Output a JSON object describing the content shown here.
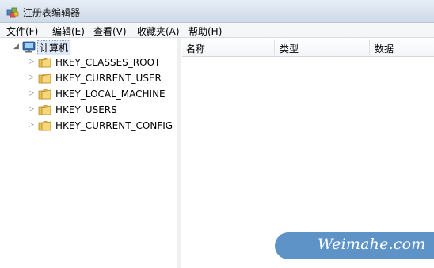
{
  "window": {
    "title": "注册表编辑器",
    "icon": "registry-editor-icon"
  },
  "menu": [
    {
      "label": "文件(F)"
    },
    {
      "label": "编辑(E)"
    },
    {
      "label": "查看(V)"
    },
    {
      "label": "收藏夹(A)"
    },
    {
      "label": "帮助(H)"
    }
  ],
  "tree": {
    "root": {
      "label": "计算机",
      "icon": "computer-icon",
      "expanded": true
    },
    "hives": [
      {
        "label": "HKEY_CLASSES_ROOT"
      },
      {
        "label": "HKEY_CURRENT_USER"
      },
      {
        "label": "HKEY_LOCAL_MACHINE"
      },
      {
        "label": "HKEY_USERS"
      },
      {
        "label": "HKEY_CURRENT_CONFIG"
      }
    ]
  },
  "list": {
    "columns": [
      {
        "label": "名称"
      },
      {
        "label": "类型"
      },
      {
        "label": "数据"
      }
    ]
  },
  "watermark": {
    "text": "Weimahe.com"
  },
  "colors": {
    "title_bar": "#dbe4ef",
    "selection": "#dfe9f6",
    "folder": "#e8c05a",
    "watermark_bg": "#5d93c7"
  }
}
